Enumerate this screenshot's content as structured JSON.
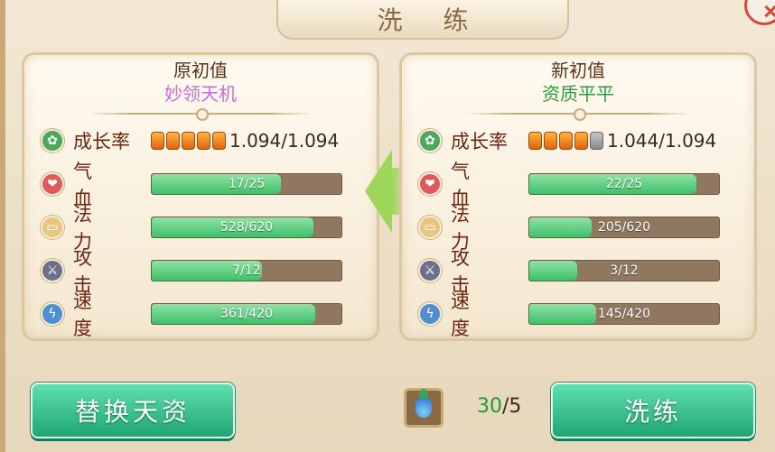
{
  "title": "洗 练",
  "left_panel": {
    "title": "原初值",
    "quality": "妙领天机",
    "growth": {
      "label": "成长率",
      "pips_filled": 5,
      "pips_total": 5,
      "value": "1.094/1.094"
    },
    "stats": [
      {
        "key": "hp",
        "label": "气 血",
        "text": "17/25",
        "ratio": 0.68
      },
      {
        "key": "mp",
        "label": "法 力",
        "text": "528/620",
        "ratio": 0.85
      },
      {
        "key": "atk",
        "label": "攻 击",
        "text": "7/12",
        "ratio": 0.58
      },
      {
        "key": "spd",
        "label": "速 度",
        "text": "361/420",
        "ratio": 0.86
      }
    ]
  },
  "right_panel": {
    "title": "新初值",
    "quality": "资质平平",
    "growth": {
      "label": "成长率",
      "pips_filled": 4,
      "pips_total": 5,
      "value": "1.044/1.094"
    },
    "stats": [
      {
        "key": "hp",
        "label": "气 血",
        "text": "22/25",
        "ratio": 0.88
      },
      {
        "key": "mp",
        "label": "法 力",
        "text": "205/620",
        "ratio": 0.33
      },
      {
        "key": "atk",
        "label": "攻 击",
        "text": "3/12",
        "ratio": 0.25
      },
      {
        "key": "spd",
        "label": "速 度",
        "text": "145/420",
        "ratio": 0.35
      }
    ]
  },
  "buttons": {
    "replace": "替换天资",
    "wash": "洗练"
  },
  "item": {
    "icon": "potion-bottle-icon",
    "have": "30",
    "separator": "/",
    "need": "5"
  },
  "colors": {
    "accent_green": "#3fbf6a",
    "title_brown": "#8a6a43",
    "quality_left": "#c56ed8",
    "quality_right": "#2f9a3c"
  }
}
